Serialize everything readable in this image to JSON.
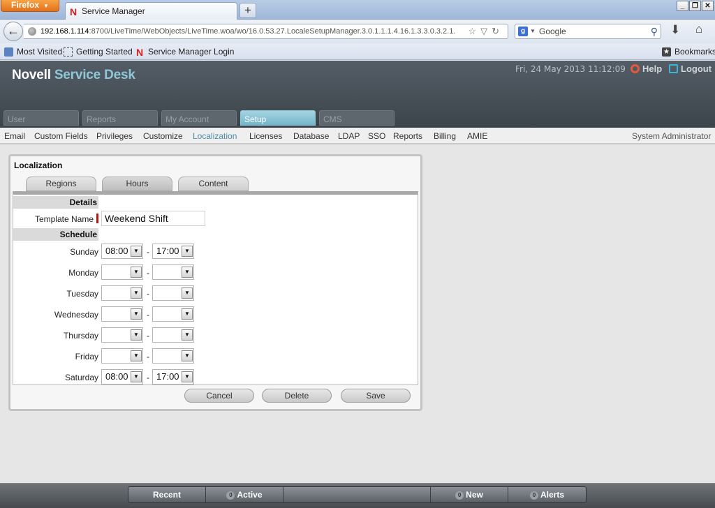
{
  "browser": {
    "menu_button": "Firefox",
    "tab_title": "Service Manager",
    "url_host": "192.168.1.114",
    "url_rest": ":8700/LiveTime/WebObjects/LiveTime.woa/wo/16.0.53.27.LocaleSetupManager.3.0.1.1.1.4.16.1.3.3.0.3.2.1.",
    "search_engine_icon": "g-icon",
    "search_placeholder": "Google",
    "bookmarks": [
      "Most Visited",
      "Getting Started",
      "Service Manager Login"
    ],
    "bookmarks_menu": "Bookmarks"
  },
  "header": {
    "logo_brand": "Novell",
    "logo_product": "Service Desk",
    "datetime": "Fri, 24 May 2013 11:12:09",
    "help_label": "Help",
    "logout_label": "Logout",
    "main_tabs": [
      {
        "label": "User"
      },
      {
        "label": "Reports"
      },
      {
        "label": "My Account"
      },
      {
        "label": "Setup",
        "active": true
      },
      {
        "label": "CMS"
      }
    ]
  },
  "subnav": {
    "items": [
      "Email",
      "Custom Fields",
      "Privileges",
      "Customize",
      "Localization",
      "Licenses",
      "Database",
      "LDAP",
      "SSO",
      "Reports",
      "Billing",
      "AMIE"
    ],
    "active": "Localization",
    "user_role": "System Administrator"
  },
  "panel": {
    "title": "Localization",
    "tabs": [
      "Regions",
      "Hours",
      "Content"
    ],
    "active_tab": "Hours",
    "details_heading": "Details",
    "template_name_label": "Template Name",
    "template_name_value": "Weekend Shift",
    "schedule_heading": "Schedule",
    "days": [
      {
        "day": "Sunday",
        "start": "08:00",
        "end": "17:00"
      },
      {
        "day": "Monday",
        "start": "",
        "end": ""
      },
      {
        "day": "Tuesday",
        "start": "",
        "end": ""
      },
      {
        "day": "Wednesday",
        "start": "",
        "end": ""
      },
      {
        "day": "Thursday",
        "start": "",
        "end": ""
      },
      {
        "day": "Friday",
        "start": "",
        "end": ""
      },
      {
        "day": "Saturday",
        "start": "08:00",
        "end": "17:00"
      }
    ],
    "separator": "-",
    "buttons": {
      "cancel": "Cancel",
      "delete": "Delete",
      "save": "Save"
    }
  },
  "bottombar": {
    "recent": "Recent",
    "active_count": "0",
    "active": "Active",
    "new_count": "0",
    "new": "New",
    "alerts_count": "0",
    "alerts": "Alerts"
  },
  "colors": {
    "accent": "#74b6cb",
    "active_link": "#4d8aa4",
    "required_marker": "#b01818"
  }
}
